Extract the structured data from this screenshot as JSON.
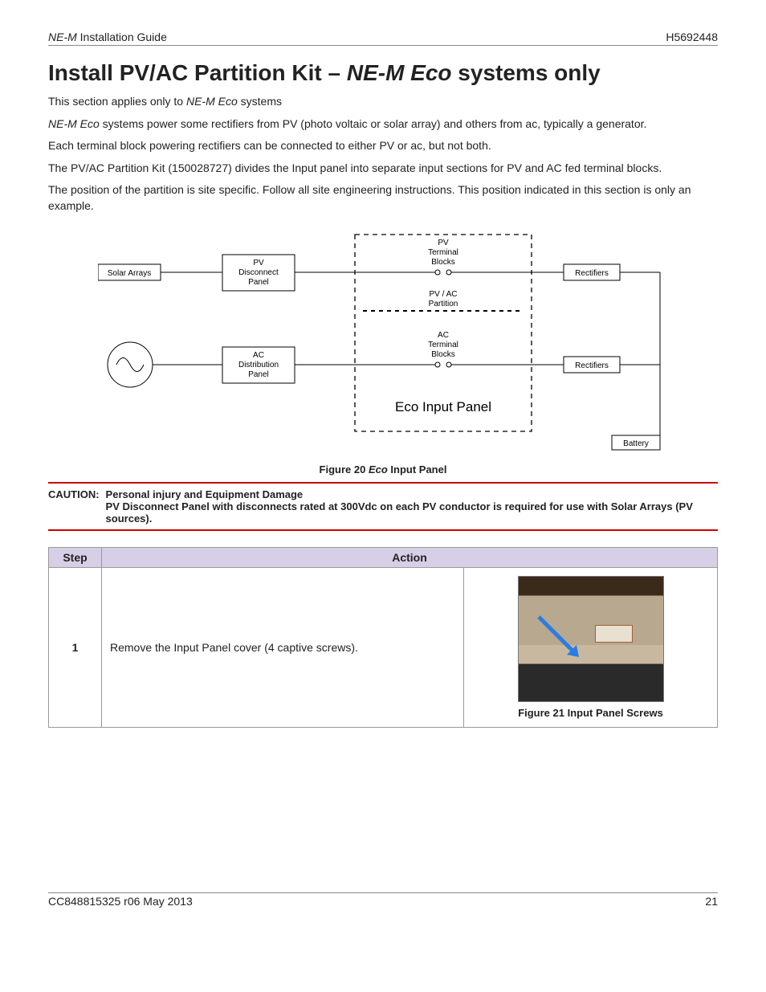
{
  "header": {
    "product": "NE-M",
    "doc_type": "Installation Guide",
    "doc_code": "H5692448"
  },
  "title": {
    "prefix": "Install PV/AC Partition Kit – ",
    "eco": "NE-M Eco",
    "suffix": " systems only"
  },
  "paragraphs": {
    "p1a": "This section applies only to ",
    "p1b": "NE-M Eco",
    "p1c": " systems",
    "p2a": "NE-M Eco",
    "p2b": " systems power some rectifiers from PV (photo voltaic or solar array) and others from ac, typically a generator.",
    "p3": "Each terminal block powering rectifiers can be connected to either PV or ac, but not both.",
    "p4": "The PV/AC Partition Kit (150028727) divides the Input panel into separate input sections for PV and AC fed terminal blocks.",
    "p5": "The position of the partition is site specific. Follow all site engineering instructions. This position indicated in this section is only an example."
  },
  "diagram": {
    "solar_arrays": "Solar Arrays",
    "pv_disc": "PV\nDisconnect\nPanel",
    "ac_dist": "AC\nDistribution\nPanel",
    "pv_tb": "PV\nTerminal\nBlocks",
    "ac_tb": "AC\nTerminal\nBlocks",
    "partition": "PV / AC\nPartition",
    "rect1": "Rectifiers",
    "rect2": "Rectifiers",
    "battery": "Battery",
    "panel_title": "Eco Input Panel"
  },
  "figure20": {
    "prefix": "Figure 20 ",
    "eco": "Eco",
    "suffix": " Input Panel"
  },
  "caution": {
    "label": "CAUTION:",
    "title": "Personal injury and Equipment Damage",
    "body": "PV Disconnect Panel with disconnects rated at 300Vdc on each PV conductor is required for use with Solar Arrays (PV sources)."
  },
  "table": {
    "col_step": "Step",
    "col_action": "Action",
    "rows": [
      {
        "step": "1",
        "action": "Remove the Input Panel cover (4 captive screws).",
        "fig": "Figure 21 Input Panel Screws"
      }
    ]
  },
  "footer": {
    "left": "CC848815325  r06   May 2013",
    "page": "21"
  }
}
